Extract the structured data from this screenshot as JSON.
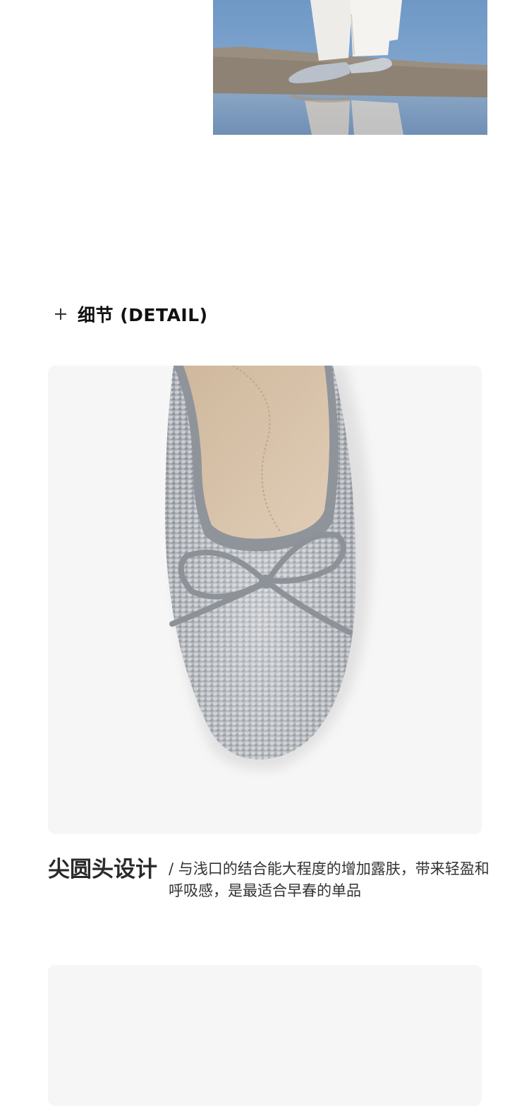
{
  "hero": {
    "image": "model-wearing-silver-sequin-flats-on-rock-by-water"
  },
  "detail_section": {
    "icon": "plus-icon",
    "title": "细节 (DETAIL)"
  },
  "detail_card": {
    "image": "silver-sequin-ballet-flat-toe-with-bow",
    "caption_title": "尖圆头设计",
    "caption_desc": "/ 与浅口的结合能大程度的增加露肤，带来轻盈和呼吸感，是最适合早春的单品"
  },
  "colors": {
    "card_background": "#f6f6f6",
    "sequin_silver": "#a9adb3",
    "insole_beige": "#d9c4ab"
  }
}
